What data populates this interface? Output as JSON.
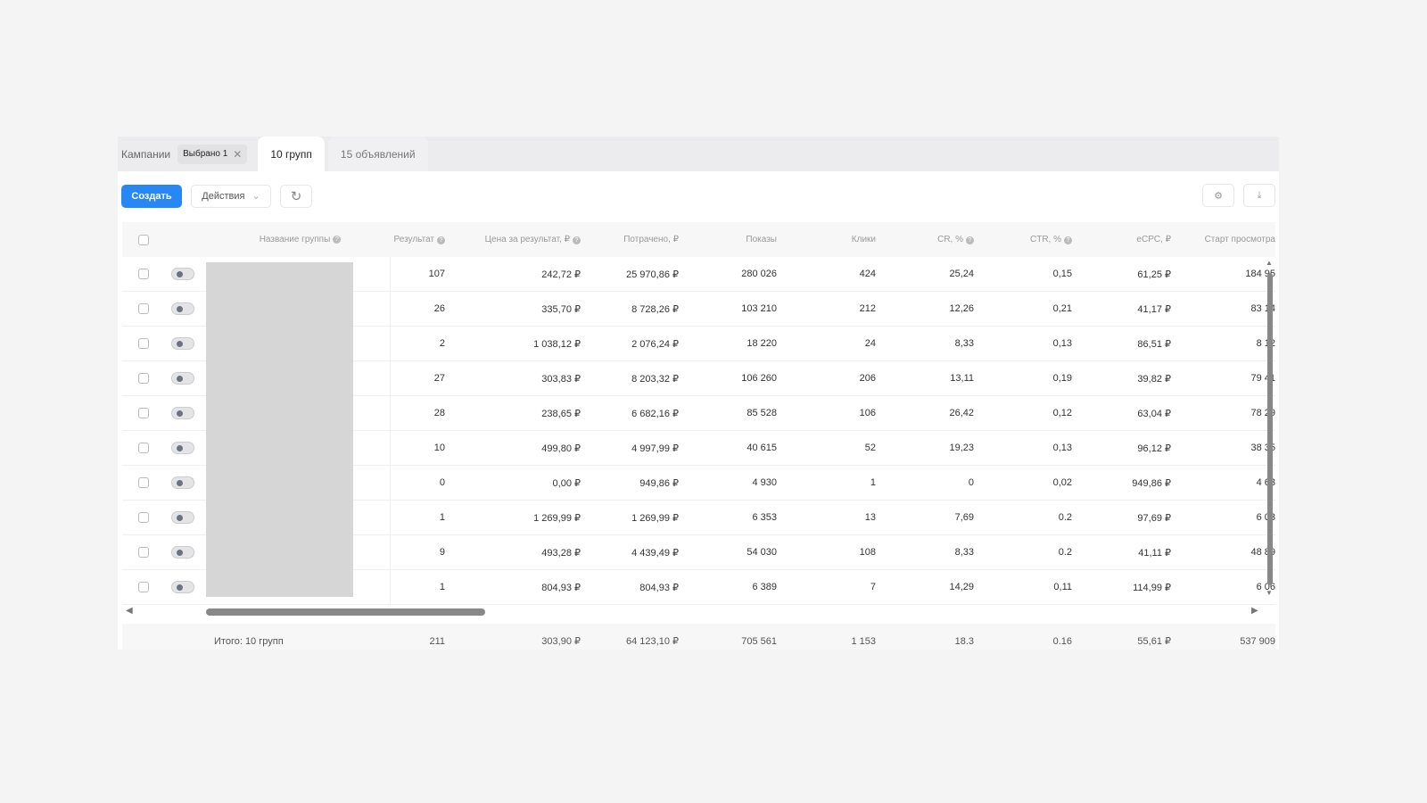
{
  "tabs": {
    "campaigns": "Кампании",
    "selected_chip": "Выбрано 1",
    "groups": "10 групп",
    "ads": "15 объявлений"
  },
  "toolbar": {
    "create": "Создать",
    "actions": "Действия"
  },
  "columns": [
    "Название группы",
    "Результат",
    "Цена за результат, ₽",
    "Потрачено, ₽",
    "Показы",
    "Клики",
    "CR, %",
    "CTR, %",
    "eCPC, ₽",
    "Старт просмотра"
  ],
  "rows": [
    [
      "107",
      "242,72 ₽",
      "25 970,86 ₽",
      "280 026",
      "424",
      "25,24",
      "0,15",
      "61,25 ₽",
      "184 95"
    ],
    [
      "26",
      "335,70 ₽",
      "8 728,26 ₽",
      "103 210",
      "212",
      "12,26",
      "0,21",
      "41,17 ₽",
      "83 14"
    ],
    [
      "2",
      "1 038,12 ₽",
      "2 076,24 ₽",
      "18 220",
      "24",
      "8,33",
      "0,13",
      "86,51 ₽",
      "8 12"
    ],
    [
      "27",
      "303,83 ₽",
      "8 203,32 ₽",
      "106 260",
      "206",
      "13,11",
      "0,19",
      "39,82 ₽",
      "79 41"
    ],
    [
      "28",
      "238,65 ₽",
      "6 682,16 ₽",
      "85 528",
      "106",
      "26,42",
      "0,12",
      "63,04 ₽",
      "78 29"
    ],
    [
      "10",
      "499,80 ₽",
      "4 997,99 ₽",
      "40 615",
      "52",
      "19,23",
      "0,13",
      "96,12 ₽",
      "38 35"
    ],
    [
      "0",
      "0,00 ₽",
      "949,86 ₽",
      "4 930",
      "1",
      "0",
      "0,02",
      "949,86 ₽",
      "4 63"
    ],
    [
      "1",
      "1 269,99 ₽",
      "1 269,99 ₽",
      "6 353",
      "13",
      "7,69",
      "0.2",
      "97,69 ₽",
      "6 03"
    ],
    [
      "9",
      "493,28 ₽",
      "4 439,49 ₽",
      "54 030",
      "108",
      "8,33",
      "0.2",
      "41,11 ₽",
      "48 89"
    ],
    [
      "1",
      "804,93 ₽",
      "804,93 ₽",
      "6 389",
      "7",
      "14,29",
      "0,11",
      "114,99 ₽",
      "6 06"
    ]
  ],
  "total": [
    "Итого: 10 групп",
    "211",
    "303,90 ₽",
    "64 123,10 ₽",
    "705 561",
    "1 153",
    "18.3",
    "0.16",
    "55,61 ₽",
    "537 909"
  ],
  "colors": {
    "primary": "#2787f5"
  }
}
